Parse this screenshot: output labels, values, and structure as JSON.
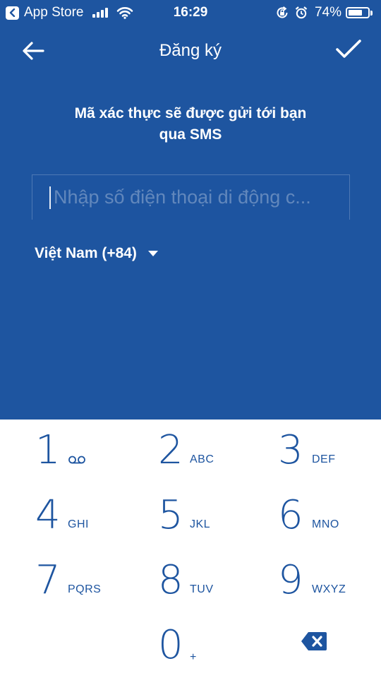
{
  "status_bar": {
    "back_app": "App Store",
    "time": "16:29",
    "battery": "74%",
    "battery_level": 0.74,
    "icons": [
      "back-arrow-icon",
      "signal-icon",
      "wifi-icon",
      "rotation-lock-icon",
      "alarm-icon",
      "battery-icon"
    ]
  },
  "nav": {
    "title": "Đăng ký",
    "back_icon": "arrow-left-icon",
    "confirm_icon": "checkmark-icon"
  },
  "instruction": {
    "line1": "Mã xác thực sẽ được gửi tới bạn",
    "line2": "qua SMS"
  },
  "phone_input": {
    "value": "",
    "placeholder": "Nhập số điện thoại di động c..."
  },
  "country": {
    "selected": "Việt Nam (+84)"
  },
  "keypad": {
    "keys": [
      {
        "digit": "1",
        "letters": ""
      },
      {
        "digit": "2",
        "letters": "ABC"
      },
      {
        "digit": "3",
        "letters": "DEF"
      },
      {
        "digit": "4",
        "letters": "GHI"
      },
      {
        "digit": "5",
        "letters": "JKL"
      },
      {
        "digit": "6",
        "letters": "MNO"
      },
      {
        "digit": "7",
        "letters": "PQRS"
      },
      {
        "digit": "8",
        "letters": "TUV"
      },
      {
        "digit": "9",
        "letters": "WXYZ"
      },
      {
        "digit": "0",
        "letters": "+"
      }
    ],
    "delete_icon": "backspace-icon"
  },
  "colors": {
    "primary": "#1e55a0",
    "on_primary": "#ffffff",
    "keypad_bg": "#ffffff"
  }
}
